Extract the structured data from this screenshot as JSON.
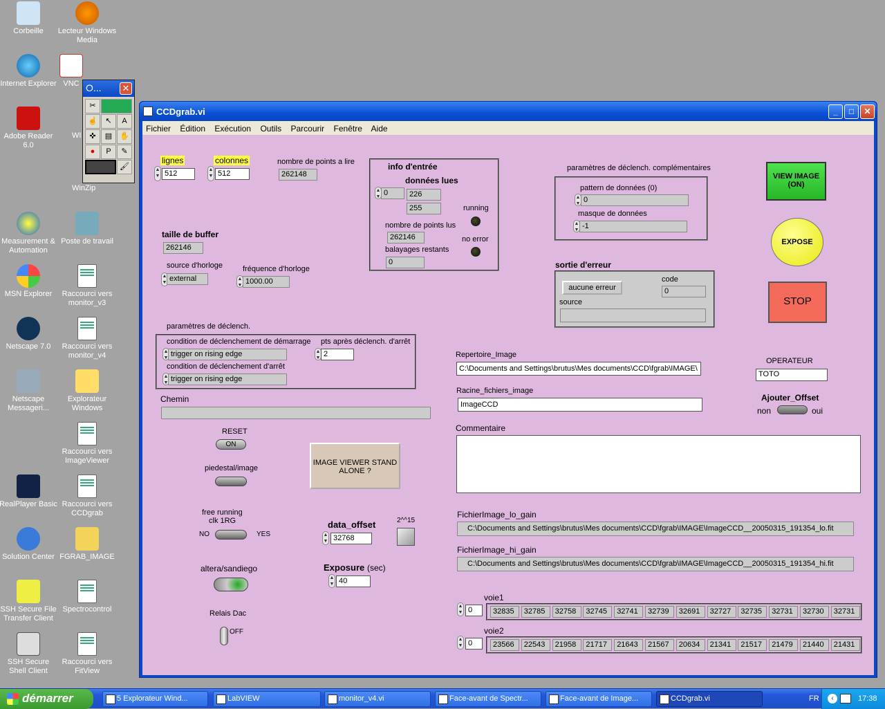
{
  "desktop": {
    "icons": [
      "Corbeille",
      "Lecteur Windows Media",
      "Internet Explorer",
      "VNC",
      "Adobe Reader 6.0",
      "WI",
      "WinZip",
      "Measurement & Automation",
      "Poste de travail",
      "MSN Explorer",
      "Raccourci vers monitor_v3",
      "Netscape 7.0",
      "Raccourci vers monitor_v4",
      "Netscape Messageri...",
      "Explorateur Windows",
      "Raccourci vers ImageViewer",
      "RealPlayer Basic",
      "Raccourci vers CCDgrab",
      "Solution Center",
      "FGRAB_IMAGE",
      "SSH Secure File Transfer Client",
      "Spectrocontrol",
      "SSH Secure Shell Client",
      "Raccourci vers FitView"
    ]
  },
  "palette": {
    "title": "O..."
  },
  "window": {
    "title": "CCDgrab.vi",
    "menu": [
      "Fichier",
      "Édition",
      "Exécution",
      "Outils",
      "Parcourir",
      "Fenêtre",
      "Aide"
    ]
  },
  "vi": {
    "lignes_label": "lignes",
    "lignes": "512",
    "colonnes_label": "colonnes",
    "colonnes": "512",
    "npts_label": "nombre de points a lire",
    "npts": "262148",
    "info_label": "info d'entrée",
    "donnees_label": "données lues",
    "donnees_idx": "0",
    "donnees": [
      "226",
      "255"
    ],
    "running_label": "running",
    "noerror_label": "no error",
    "npts_lus_label": "nombre de points lus",
    "npts_lus": "262146",
    "balayages_label": "balayages restants",
    "balayages": "0",
    "buffer_label": "taille de buffer",
    "buffer": "262146",
    "source_label": "source d'horloge",
    "source": "external",
    "freq_label": "fréquence d'horloge",
    "freq": "1000.00",
    "compl_label": "paramètres de déclench. complémentaires",
    "pattern_label": "pattern de données (0)",
    "pattern": "0",
    "masque_label": "masque de données",
    "masque": "-1",
    "view_image": "VIEW IMAGE (ON)",
    "expose": "EXPOSE",
    "stop": "STOP",
    "err_label": "sortie d'erreur",
    "err_status": "aucune erreur",
    "err_code_label": "code",
    "err_code": "0",
    "err_source_label": "source",
    "declench_label": "paramètres de déclench.",
    "cond_start_label": "condition de déclenchement de démarrage",
    "cond_start": "trigger on rising edge",
    "pts_apres_label": "pts après déclench. d'arrêt",
    "pts_apres": "2",
    "cond_stop_label": "condition de déclenchement d'arrêt",
    "cond_stop": "trigger on rising edge",
    "chemin_label": "Chemin",
    "rep_label": "Repertoire_Image",
    "rep": "C:\\Documents and Settings\\brutus\\Mes documents\\CCD\\fgrab\\IMAGE\\",
    "racine_label": "Racine_fichiers_image",
    "racine": "ImageCCD",
    "operateur_label": "OPERATEUR",
    "operateur": "TOTO",
    "offset_label": "Ajouter_Offset",
    "offset_non": "non",
    "offset_oui": "oui",
    "commentaire_label": "Commentaire",
    "reset_label": "RESET",
    "reset_state": "ON",
    "piedestal_label": "piedestal/image",
    "viewer_btn": "IMAGE VIEWER STAND ALONE ?",
    "free_label": "free running",
    "clk_label": "clk 1RG",
    "no": "NO",
    "yes": "YES",
    "data_offset_label": "data_offset",
    "data_offset": "32768",
    "pow_label": "2^^15",
    "altera_label": "altera/sandiego",
    "exposure_label": "Exposure",
    "exposure_unit": "(sec)",
    "exposure": "40",
    "relais_label": "Relais Dac",
    "relais_state": "OFF",
    "lo_label": "FichierImage_lo_gain",
    "lo": "C:\\Documents and Settings\\brutus\\Mes documents\\CCD\\fgrab\\IMAGE\\ImageCCD__20050315_191354_lo.fit",
    "hi_label": "FichierImage_hi_gain",
    "hi": "C:\\Documents and Settings\\brutus\\Mes documents\\CCD\\fgrab\\IMAGE\\ImageCCD__20050315_191354_hi.fit",
    "voie1_label": "voie1",
    "voie1_idx": "0",
    "voie1": [
      "32835",
      "32785",
      "32758",
      "32745",
      "32741",
      "32739",
      "32691",
      "32727",
      "32735",
      "32731",
      "32730",
      "32731"
    ],
    "voie2_label": "voie2",
    "voie2_idx": "0",
    "voie2": [
      "23566",
      "22543",
      "21958",
      "21717",
      "21643",
      "21567",
      "20634",
      "21341",
      "21517",
      "21479",
      "21440",
      "21431"
    ]
  },
  "taskbar": {
    "start": "démarrer",
    "tasks": [
      "5 Explorateur Wind...",
      "LabVIEW",
      "monitor_v4.vi",
      "Face-avant de Spectr...",
      "Face-avant de Image...",
      "CCDgrab.vi"
    ],
    "lang": "FR",
    "time": "17:38"
  }
}
